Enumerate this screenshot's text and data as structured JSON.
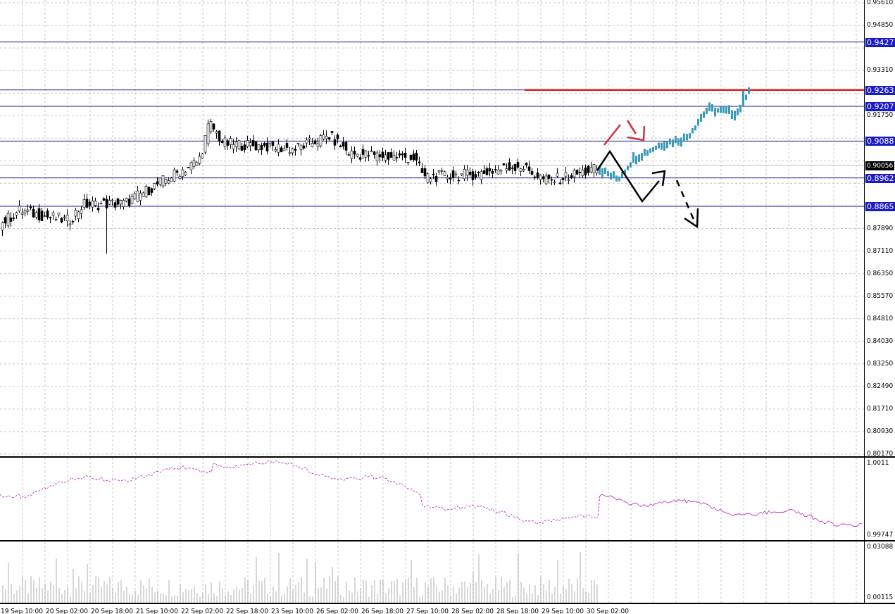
{
  "price_axis": {
    "ticks": [
      "0.95610",
      "0.94850",
      "0.93310",
      "0.91750",
      "0.87890",
      "0.87110",
      "0.86350",
      "0.85570",
      "0.84810",
      "0.84030",
      "0.83250",
      "0.82490",
      "0.81710",
      "0.80930",
      "0.80170"
    ]
  },
  "levels": [
    {
      "label": "0.9427",
      "kind": "level"
    },
    {
      "label": "0.9263",
      "kind": "level"
    },
    {
      "label": "0.9207",
      "kind": "level"
    },
    {
      "label": "0.9088",
      "kind": "level"
    },
    {
      "label": "0.90056",
      "kind": "bid"
    },
    {
      "label": "0.8962",
      "kind": "level"
    },
    {
      "label": "0.8865",
      "kind": "level"
    }
  ],
  "indicator_panel": {
    "axis_labels": [
      "1.0011",
      "0.99747"
    ]
  },
  "volume_panel": {
    "axis_labels": [
      "0.03088",
      "0.00115"
    ]
  },
  "time_axis": {
    "labels": [
      "19 Sep 10:00",
      "20 Sep 02:00",
      "20 Sep 18:00",
      "21 Sep 10:00",
      "22 Sep 02:00",
      "22 Sep 18:00",
      "23 Sep 10:00",
      "26 Sep 02:00",
      "26 Sep 18:00",
      "27 Sep 10:00",
      "28 Sep 02:00",
      "28 Sep 18:00",
      "29 Sep 10:00",
      "30 Sep 02:00"
    ]
  }
}
